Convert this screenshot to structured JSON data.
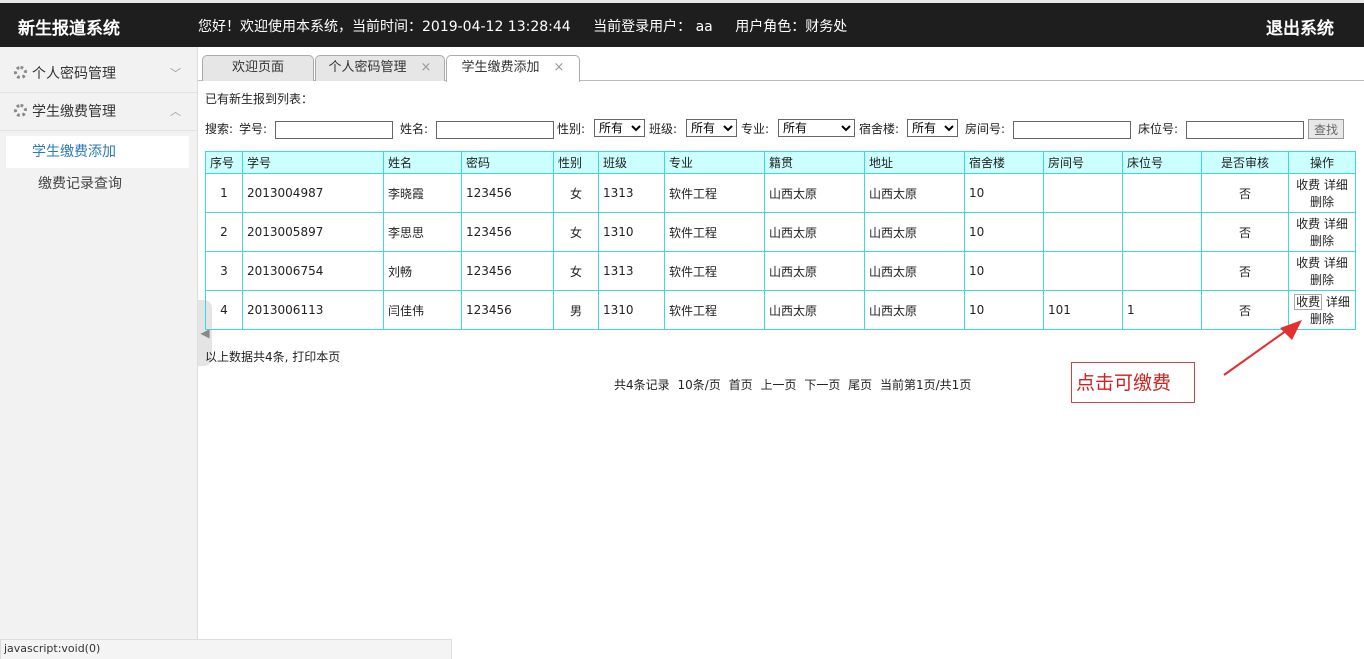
{
  "header": {
    "brand": "新生报道系统",
    "greeting": "您好！欢迎使用本系统，当前时间：2019-04-12 13:28:44",
    "user_label": "当前登录用户： aa",
    "role_label": "用户角色：财务处",
    "logout": "退出系统"
  },
  "sidebar": {
    "groups": [
      {
        "label": "个人密码管理",
        "chevron": "﹀"
      },
      {
        "label": "学生缴费管理",
        "chevron": "︿"
      }
    ],
    "items": [
      {
        "label": "学生缴费添加"
      },
      {
        "label": "缴费记录查询"
      }
    ],
    "collapse_glyph": "◀"
  },
  "tabs": [
    {
      "label": "欢迎页面"
    },
    {
      "label": "个人密码管理",
      "close": "×"
    },
    {
      "label": "学生缴费添加",
      "close": "×"
    }
  ],
  "main": {
    "list_title": "已有新生报到列表：",
    "search": {
      "label": "搜索:",
      "student_no_label": "学号:",
      "name_label": "姓名:",
      "gender_label": "性别:",
      "gender_value": "所有",
      "class_label": "班级:",
      "class_value": "所有",
      "major_label": "专业:",
      "major_value": "所有",
      "dorm_label": "宿舍楼:",
      "dorm_value": "所有",
      "room_label": "房间号:",
      "bed_label": "床位号:",
      "button": "查找"
    },
    "table": {
      "headers": [
        "序号",
        "学号",
        "姓名",
        "密码",
        "性别",
        "班级",
        "专业",
        "籍贯",
        "地址",
        "宿舍楼",
        "房间号",
        "床位号",
        "是否审核",
        "操作"
      ],
      "rows": [
        [
          "1",
          "2013004987",
          "李晓霞",
          "123456",
          "女",
          "1313",
          "软件工程",
          "山西太原",
          "山西太原",
          "10",
          "",
          "",
          "否"
        ],
        [
          "2",
          "2013005897",
          "李思思",
          "123456",
          "女",
          "1310",
          "软件工程",
          "山西太原",
          "山西太原",
          "10",
          "",
          "",
          "否"
        ],
        [
          "3",
          "2013006754",
          "刘畅",
          "123456",
          "女",
          "1313",
          "软件工程",
          "山西太原",
          "山西太原",
          "10",
          "",
          "",
          "否"
        ],
        [
          "4",
          "2013006113",
          "闫佳伟",
          "123456",
          "男",
          "1310",
          "软件工程",
          "山西太原",
          "山西太原",
          "10",
          "101",
          "1",
          "否"
        ]
      ],
      "ops": {
        "charge": "收费",
        "detail": "详细",
        "delete": "删除"
      }
    },
    "summary": "以上数据共4条, 打印本页",
    "pager": {
      "total": "共4条记录",
      "per_page": "10条/页",
      "first": "首页",
      "prev": "上一页",
      "next": "下一页",
      "last": "尾页",
      "current": "当前第1页/共1页"
    }
  },
  "annotation": {
    "text": "点击可缴费",
    "color": "#d02020"
  },
  "statusbar": "javascript:void(0)"
}
